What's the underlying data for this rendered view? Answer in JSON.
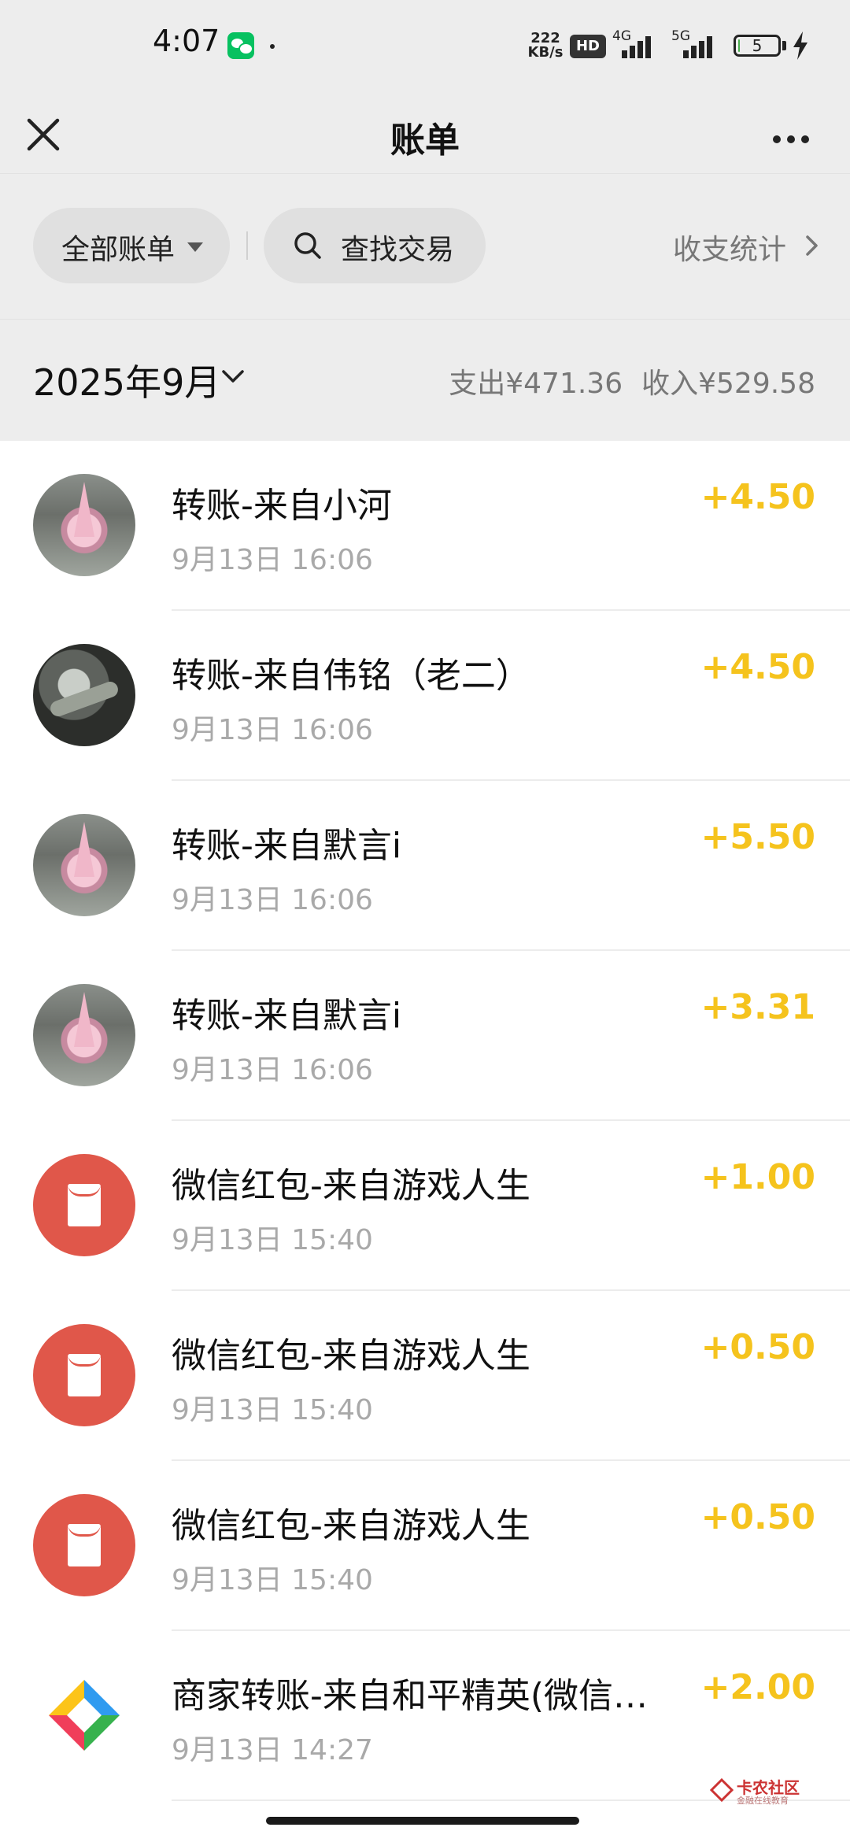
{
  "status_bar": {
    "time": "4:07",
    "net_speed_value": "222",
    "net_speed_unit": "KB/s",
    "hd_label": "HD",
    "sim1_label": "4G",
    "sim2_label": "5G",
    "battery_level": "5",
    "battery_fraction": 0.05
  },
  "header": {
    "title": "账单"
  },
  "filters": {
    "all_bills_label": "全部账单",
    "search_label": "查找交易",
    "stats_label": "收支统计"
  },
  "month": {
    "label": "2025年9月",
    "expense": "支出¥471.36",
    "income": "收入¥529.58"
  },
  "transactions": [
    {
      "title": "转账-来自小河",
      "time": "9月13日 16:06",
      "amount": "+4.50",
      "avatar": "photo-a"
    },
    {
      "title": "转账-来自伟铭（老二）",
      "time": "9月13日 16:06",
      "amount": "+4.50",
      "avatar": "photo-b"
    },
    {
      "title": "转账-来自默言i",
      "time": "9月13日 16:06",
      "amount": "+5.50",
      "avatar": "photo-a"
    },
    {
      "title": "转账-来自默言i",
      "time": "9月13日 16:06",
      "amount": "+3.31",
      "avatar": "photo-a"
    },
    {
      "title": "微信红包-来自游戏人生",
      "time": "9月13日 15:40",
      "amount": "+1.00",
      "avatar": "red-packet-icon"
    },
    {
      "title": "微信红包-来自游戏人生",
      "time": "9月13日 15:40",
      "amount": "+0.50",
      "avatar": "red-packet-icon"
    },
    {
      "title": "微信红包-来自游戏人生",
      "time": "9月13日 15:40",
      "amount": "+0.50",
      "avatar": "red-packet-icon"
    },
    {
      "title": "商家转账-来自和平精英(微信…",
      "time": "9月13日 14:27",
      "amount": "+2.00",
      "avatar": "merchant-logo-icon"
    }
  ],
  "watermark": {
    "title": "卡农社区",
    "subtitle": "金融在线教育"
  },
  "colors": {
    "amount": "#f5c31d",
    "red_packet": "#e0574a",
    "background": "#ededed"
  }
}
